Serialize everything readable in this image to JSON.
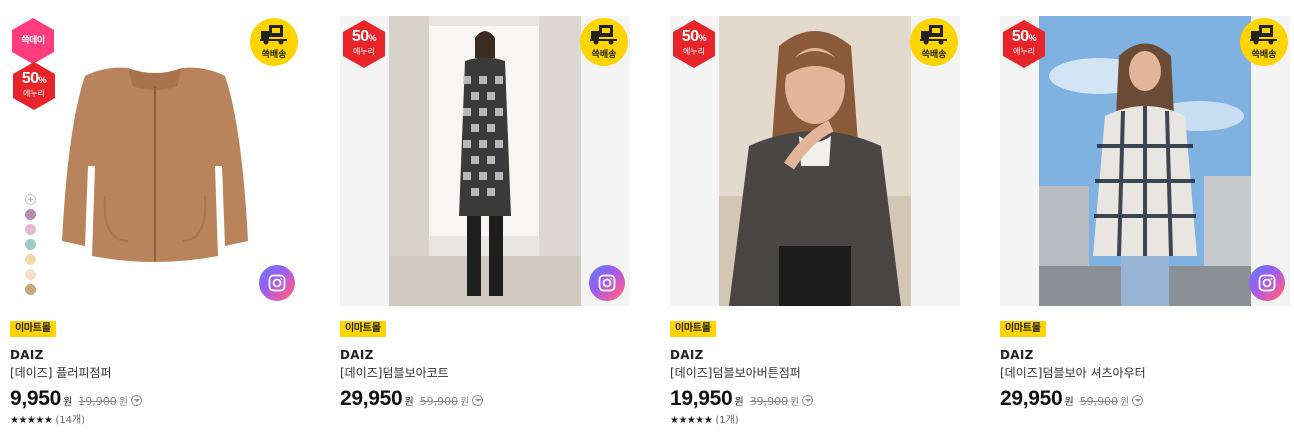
{
  "badges": {
    "ssg_day": "쓱데이",
    "discount_pct": "50",
    "discount_unit": "%",
    "discount_label": "에누리",
    "shipping_label": "쓱배송",
    "mall_tag": "이마트몰",
    "currency": "원"
  },
  "products": [
    {
      "brand": "DAIZ",
      "name": "[데이즈] 플러피점퍼",
      "price": "9,950",
      "original_price": "19,900",
      "stars": "★★★★★",
      "reviews": "(14개)",
      "colors": [
        "#b98ab3",
        "#e1b9d2",
        "#9fcbc2",
        "#f4d9a4",
        "#f3e1cd",
        "#c9a67c"
      ]
    },
    {
      "brand": "DAIZ",
      "name": "[데이즈]덤블보아코트",
      "price": "29,950",
      "original_price": "59,900"
    },
    {
      "brand": "DAIZ",
      "name": "[데이즈]덤블보아버튼점퍼",
      "price": "19,950",
      "original_price": "39,900",
      "stars": "★★★★★",
      "reviews": "(1개)"
    },
    {
      "brand": "DAIZ",
      "name": "[데이즈]덤블보아 셔츠아우터",
      "price": "29,950",
      "original_price": "59,900"
    }
  ],
  "colors": {
    "discount_red": "#e8242b",
    "ssg_pink": "#ff3c7d",
    "shipping_yellow": "#ffd400"
  }
}
